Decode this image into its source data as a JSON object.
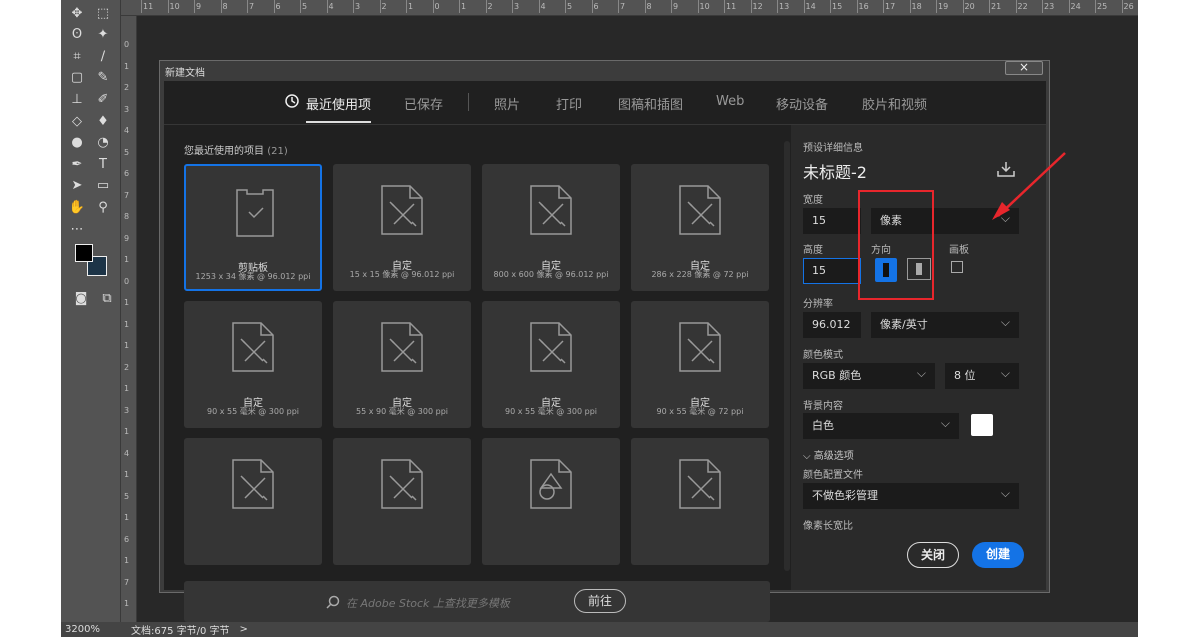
{
  "app": {
    "ruler_top_ticks": [
      "11",
      "10",
      "9",
      "8",
      "7",
      "6",
      "5",
      "4",
      "3",
      "2",
      "1",
      "0",
      "1",
      "2",
      "3",
      "4",
      "5",
      "6",
      "7",
      "8",
      "9",
      "10",
      "11",
      "12",
      "13",
      "14",
      "15",
      "16",
      "17",
      "18",
      "19",
      "20",
      "21",
      "22",
      "23",
      "24",
      "25",
      "26",
      "27"
    ],
    "ruler_left_ticks": [
      "0",
      "1",
      "2",
      "3",
      "4",
      "5",
      "6",
      "7",
      "8",
      "9",
      "1",
      "0",
      "1",
      "1",
      "1",
      "2",
      "1",
      "3",
      "1",
      "4",
      "1",
      "5",
      "1",
      "6",
      "1",
      "7",
      "1",
      "8"
    ],
    "status": {
      "zoom": "3200%",
      "doc": "文档:675 字节/0 字节",
      "arrow": ">"
    }
  },
  "dialog": {
    "title": "新建文档",
    "close": "×",
    "tabs": [
      {
        "label": "最近使用项",
        "active": true
      },
      {
        "label": "已保存"
      },
      {
        "label": "照片"
      },
      {
        "label": "打印"
      },
      {
        "label": "图稿和插图"
      },
      {
        "label": "Web"
      },
      {
        "label": "移动设备"
      },
      {
        "label": "胶片和视频"
      }
    ],
    "recent_title": "您最近使用的项目",
    "recent_count": "(21)",
    "cards": [
      {
        "name": "剪贴板",
        "desc": "1253 x 34 像素 @ 96.012 ppi",
        "icon": "clipboard",
        "selected": true
      },
      {
        "name": "自定",
        "desc": "15 x 15 像素 @ 96.012 ppi",
        "icon": "custom"
      },
      {
        "name": "自定",
        "desc": "800 x 600 像素 @ 96.012 ppi",
        "icon": "custom"
      },
      {
        "name": "自定",
        "desc": "286 x 228 像素 @ 72 ppi",
        "icon": "custom"
      },
      {
        "name": "自定",
        "desc": "90 x 55 毫米 @ 300 ppi",
        "icon": "custom"
      },
      {
        "name": "自定",
        "desc": "55 x 90 毫米 @ 300 ppi",
        "icon": "custom"
      },
      {
        "name": "自定",
        "desc": "90 x 55 毫米 @ 300 ppi",
        "icon": "custom"
      },
      {
        "name": "自定",
        "desc": "90 x 55 毫米 @ 72 ppi",
        "icon": "custom"
      },
      {
        "name": "",
        "desc": "",
        "icon": "custom"
      },
      {
        "name": "",
        "desc": "",
        "icon": "custom"
      },
      {
        "name": "",
        "desc": "",
        "icon": "shapes"
      },
      {
        "name": "",
        "desc": "",
        "icon": "custom"
      }
    ],
    "search_placeholder": "在 Adobe Stock 上查找更多模板",
    "goto": "前往",
    "preset": {
      "header": "预设详细信息",
      "name": "未标题-2",
      "width_label": "宽度",
      "width": "15",
      "unit": "像素",
      "height_label": "高度",
      "height": "15",
      "orientation_label": "方向",
      "artboard_label": "画板",
      "resolution_label": "分辨率",
      "resolution": "96.012",
      "res_unit": "像素/英寸",
      "color_mode_label": "颜色模式",
      "color_mode": "RGB 颜色",
      "bit_depth": "8 位",
      "bg_label": "背景内容",
      "bg": "白色",
      "bg_color": "#ffffff",
      "advanced": "高级选项",
      "color_profile_label": "颜色配置文件",
      "color_profile": "不做色彩管理",
      "pixel_aspect_label": "像素长宽比",
      "close_btn": "关闭",
      "create_btn": "创建"
    }
  },
  "colors": {
    "accent": "#1473e6",
    "annotation": "#e8262c"
  }
}
